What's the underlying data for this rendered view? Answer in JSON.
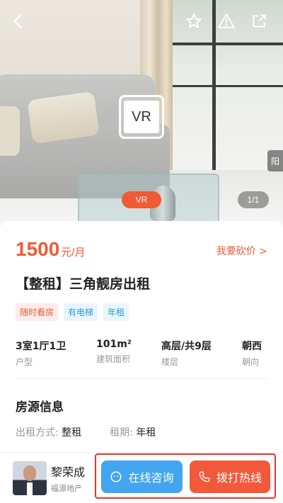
{
  "photo": {
    "vr_badge": "VR",
    "vr_pill": "VR",
    "counter": "1/1",
    "side_tab": "阳"
  },
  "listing": {
    "price": "1500",
    "price_unit": "元/月",
    "bargain_link": "我要砍价 >",
    "title": "【整租】三角靓房出租",
    "tags": [
      {
        "label": "随时看房",
        "color": "#f05a34"
      },
      {
        "label": "有电梯",
        "color": "#2d9bd9"
      },
      {
        "label": "年租",
        "color": "#2d9bd9"
      }
    ],
    "specs": [
      {
        "value": "3室1厅1卫",
        "label": "户型"
      },
      {
        "value": "101m²",
        "label": "建筑面积"
      },
      {
        "value": "高层/共9层",
        "label": "楼层"
      },
      {
        "value": "朝西",
        "label": "朝向"
      }
    ]
  },
  "section": {
    "title": "房源信息",
    "rent_method_label": "出租方式:",
    "rent_method_value": "整租",
    "lease_label": "租期:",
    "lease_value": "年租"
  },
  "agent": {
    "name": "黎荣成",
    "company": "福源地产"
  },
  "actions": {
    "consult": "在线咨询",
    "call": "拨打热线"
  },
  "colors": {
    "accent": "#f05a34",
    "consult_blue": "#43a5ef",
    "call_red": "#f2593b"
  }
}
